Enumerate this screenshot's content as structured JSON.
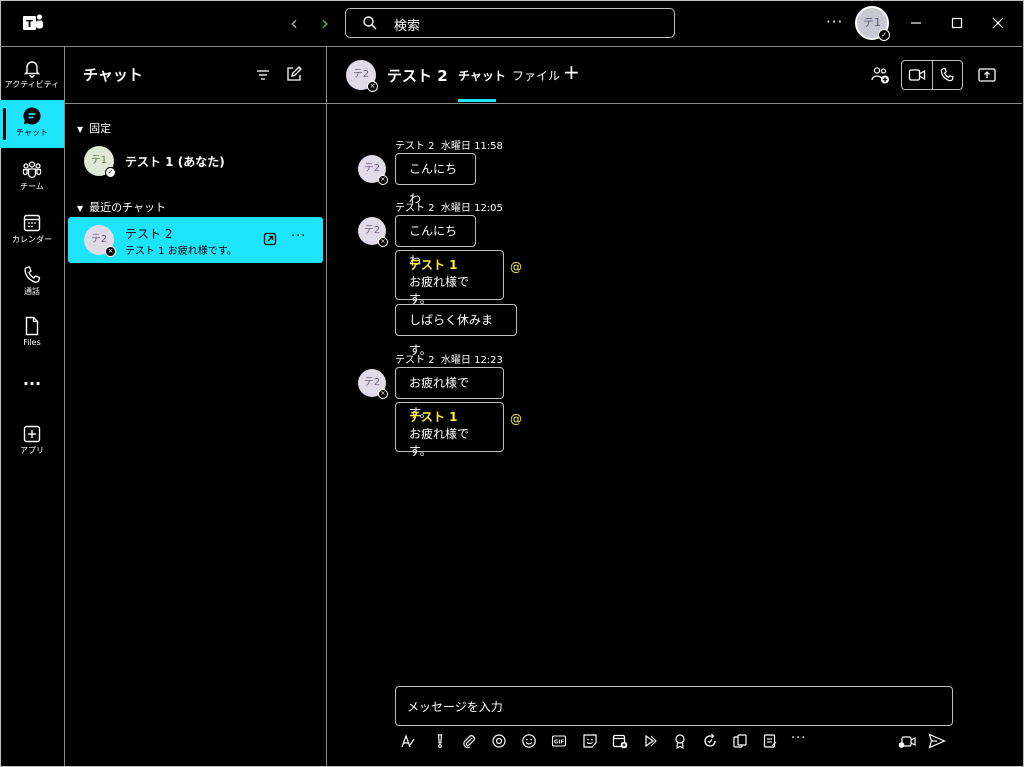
{
  "titlebar": {
    "nav_back": "‹",
    "nav_forward": "›",
    "search_placeholder": "検索",
    "more": "···",
    "avatar_initials": "テ1"
  },
  "rail": [
    {
      "label": "アクティビティ",
      "icon": "bell-icon"
    },
    {
      "label": "チャット",
      "icon": "chat-icon",
      "active": true
    },
    {
      "label": "チーム",
      "icon": "teams-icon"
    },
    {
      "label": "カレンダー",
      "icon": "calendar-icon"
    },
    {
      "label": "通話",
      "icon": "phone-icon"
    },
    {
      "label": "Files",
      "icon": "file-icon"
    },
    {
      "label": "···",
      "icon": "more-icon"
    },
    {
      "label": "アプリ",
      "icon": "apps-icon"
    }
  ],
  "chat_list": {
    "title": "チャット",
    "pinned_label": "固定",
    "recent_label": "最近のチャット",
    "pinned": {
      "name": "テスト 1 (あなた)",
      "initials": "テ1"
    },
    "recent": {
      "name": "テスト 2",
      "preview": "テスト 1 お疲れ様です。",
      "initials": "テ2",
      "more": "···"
    }
  },
  "conversation": {
    "name": "テスト 2",
    "initials": "テ2",
    "tabs": [
      "チャット",
      "ファイル"
    ],
    "add_tab": "+",
    "groups": [
      {
        "sender": "テスト 2",
        "time": "水曜日 11:58",
        "messages": [
          {
            "text": "こんにちわ"
          }
        ]
      },
      {
        "sender": "テスト 2",
        "time": "水曜日 12:05",
        "messages": [
          {
            "text": "こんにちわ"
          },
          {
            "mention": "テスト 1",
            "text": "お疲れ様です。",
            "at": "@"
          },
          {
            "text": "しばらく休みます。"
          }
        ]
      },
      {
        "sender": "テスト 2",
        "time": "水曜日 12:23",
        "messages": [
          {
            "text": "お疲れ様です。"
          },
          {
            "mention": "テスト 1",
            "text": "お疲れ様です。",
            "at": "@"
          }
        ]
      }
    ]
  },
  "compose": {
    "placeholder": "メッセージを入力",
    "toolbar": [
      "format-icon",
      "priority-icon",
      "attach-icon",
      "loop-icon",
      "emoji-icon",
      "gif-icon",
      "sticker-icon",
      "schedule-meeting-icon",
      "stream-icon",
      "praise-icon",
      "updates-icon",
      "approvals-icon",
      "forms-icon",
      "more-icon"
    ],
    "toolbar_more": "···"
  },
  "colors": {
    "accent": "#1ce5fb",
    "mention": "#ffef3a",
    "nav_forward": "#3fc34a",
    "border": "#bfbfbf"
  }
}
